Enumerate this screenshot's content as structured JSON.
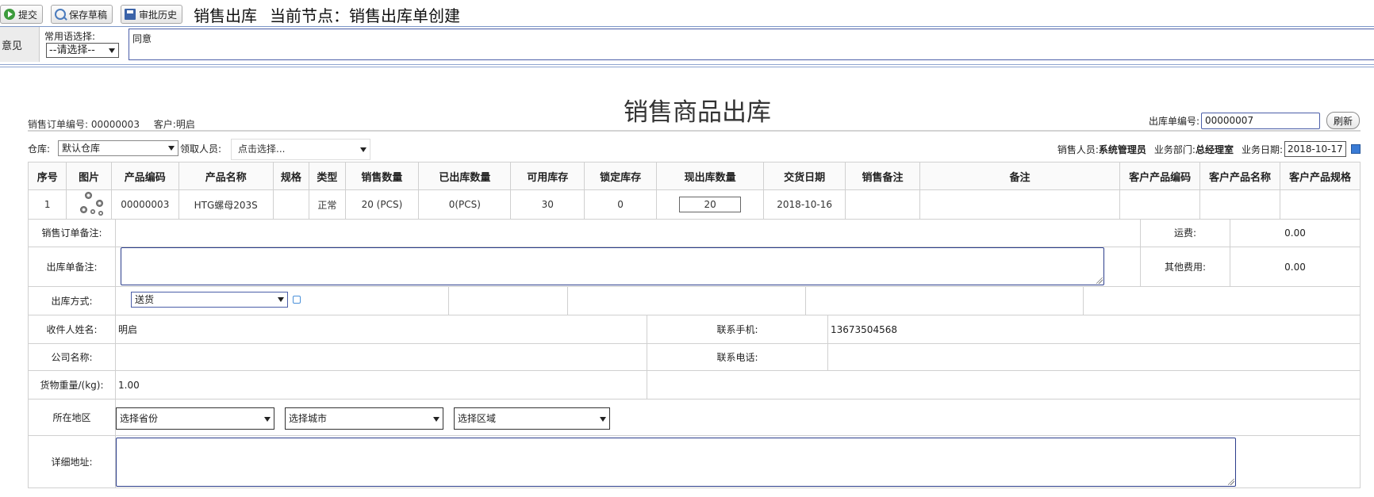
{
  "toolbar": {
    "submit_label": "提交",
    "draft_label": "保存草稿",
    "history_label": "审批历史",
    "title_module": "销售出库",
    "title_node": "当前节点：销售出库单创建"
  },
  "opinion": {
    "label": "意见",
    "phrase_label": "常用语选择:",
    "phrase_selected": "--请选择--",
    "text": "同意"
  },
  "form": {
    "title": "销售商品出库",
    "order_no_label": "销售订单编号:",
    "order_no": "00000003",
    "customer_label": "客户:",
    "customer": "明启",
    "outbound_no_label": "出库单编号:",
    "outbound_no": "00000007",
    "refresh_label": "刷新"
  },
  "filters": {
    "warehouse_label": "仓库:",
    "warehouse_value": "默认仓库",
    "picker_label": "领取人员:",
    "picker_placeholder": "点击选择...",
    "sales_person_label": "销售人员:",
    "sales_person": "系统管理员",
    "dept_label": "业务部门:",
    "dept": "总经理室",
    "date_label": "业务日期:",
    "date": "2018-10-17"
  },
  "table": {
    "headers": [
      "序号",
      "图片",
      "产品编码",
      "产品名称",
      "规格",
      "类型",
      "销售数量",
      "已出库数量",
      "可用库存",
      "锁定库存",
      "现出库数量",
      "交货日期",
      "销售备注",
      "备注",
      "客户产品编码",
      "客户产品名称",
      "客户产品规格"
    ],
    "rows": [
      {
        "index": "1",
        "code": "00000003",
        "name": "HTG螺母203S",
        "spec": "",
        "type": "正常",
        "sale_qty": "20 (PCS)",
        "shipped_qty": "0(PCS)",
        "available": "30",
        "locked": "0",
        "current_qty": "20",
        "delivery_date": "2018-10-16",
        "sale_note": "",
        "note": "",
        "cust_code": "",
        "cust_name": "",
        "cust_spec": ""
      }
    ]
  },
  "details": {
    "order_note_label": "销售订单备注:",
    "freight_label": "运费:",
    "freight": "0.00",
    "outbound_note_label": "出库单备注:",
    "other_fee_label": "其他费用:",
    "other_fee": "0.00",
    "ship_method_label": "出库方式:",
    "ship_method": "送货",
    "receiver_label": "收件人姓名:",
    "receiver": "明启",
    "mobile_label": "联系手机:",
    "mobile": "13673504568",
    "company_label": "公司名称:",
    "phone_label": "联系电话:",
    "weight_label": "货物重量/(kg):",
    "weight": "1.00",
    "region_label": "所在地区",
    "province_placeholder": "选择省份",
    "city_placeholder": "选择城市",
    "district_placeholder": "选择区域",
    "address_label": "详细地址:"
  }
}
